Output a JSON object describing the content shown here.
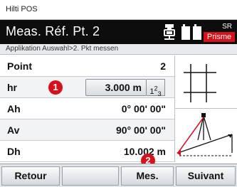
{
  "app": {
    "title": "Hilti POS"
  },
  "header": {
    "title": "Meas. Réf. Pt. 2",
    "icons": [
      "survey-pole-icon",
      "battery-icon"
    ],
    "reflector": {
      "mode": "SR",
      "type": "Prisme"
    }
  },
  "breadcrumb": "Applikation Auswahl>2. Pkt messen",
  "table": {
    "rows": [
      {
        "label": "Point",
        "value": "2"
      },
      {
        "label": "hr",
        "value": "3.000 m",
        "keypad": "123"
      },
      {
        "label": "Ah",
        "value": "0° 00' 00\""
      },
      {
        "label": "Av",
        "value": "90° 00' 00\""
      },
      {
        "label": "Dh",
        "value": "10.002 m"
      }
    ]
  },
  "markers": [
    "1",
    "2"
  ],
  "softkeys": {
    "back": "Retour",
    "empty": "",
    "measure": "Mes.",
    "next": "Suivant"
  },
  "colors": {
    "header_bg": "#0d0d0d",
    "accent_red": "#d8101a",
    "footer_bg": "#e1e4e8"
  }
}
